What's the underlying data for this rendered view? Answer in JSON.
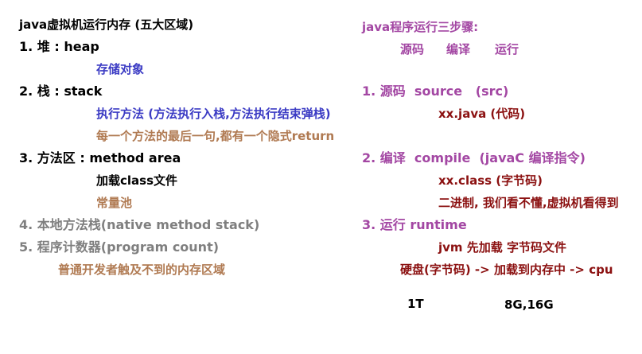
{
  "colors": {
    "black": "#000000",
    "blue": "#3b3bc4",
    "brown": "#b07a52",
    "gray": "#7f7f7f",
    "purple": "#a347a3",
    "darkred": "#8b1010"
  },
  "left": {
    "title": "java虚拟机运行内存 (五大区域)",
    "heap": {
      "heading": "1. 堆 : heap",
      "desc": "存储对象"
    },
    "stack": {
      "heading": "2. 栈 : stack",
      "desc1": "执行方法 (方法执行入栈,方法执行结束弹栈)",
      "desc2": "每一个方法的最后一句,都有一个隐式return"
    },
    "method_area": {
      "heading": "3. 方法区 : method area",
      "desc1": "加载class文件",
      "desc2": "常量池"
    },
    "native_stack": {
      "heading": "4. 本地方法栈(native method stack)"
    },
    "pc": {
      "heading": "5. 程序计数器(program count)"
    },
    "note": "普通开发者触及不到的内存区域"
  },
  "right": {
    "title": "java程序运行三步骤:",
    "steps_row": [
      "源码",
      "编译",
      "运行"
    ],
    "source": {
      "heading": "1. 源码  source   (src)",
      "desc": "xx.java (代码)"
    },
    "compile": {
      "heading": "2. 编译  compile  (javaC 编译指令)",
      "desc1": "xx.class (字节码)",
      "desc2": "二进制, 我们看不懂,虚拟机看得到"
    },
    "runtime": {
      "heading": "3. 运行 runtime",
      "desc1": "jvm 先加载 字节码文件",
      "desc2": "硬盘(字节码) -> 加载到内存中 -> cpu"
    },
    "size_disk": "1T",
    "size_mem": "8G,16G"
  }
}
